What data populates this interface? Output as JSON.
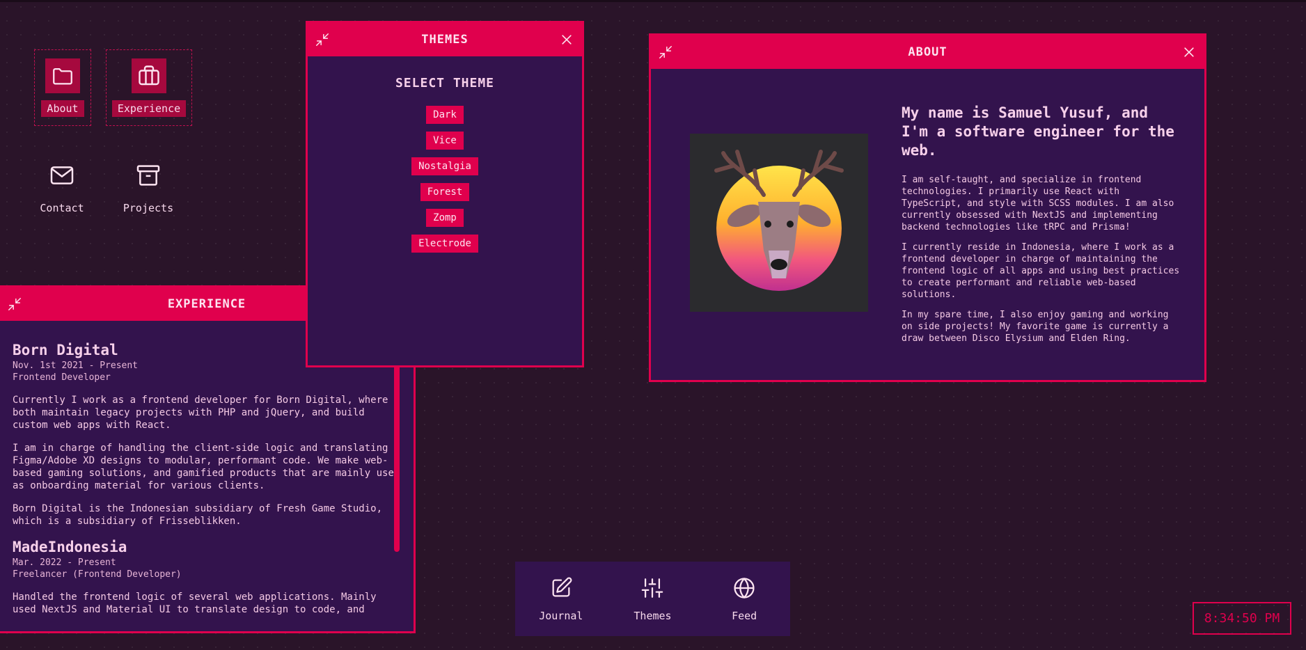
{
  "desktop": {
    "icons": [
      {
        "label": "About",
        "icon": "folder-icon",
        "selected": true
      },
      {
        "label": "Experience",
        "icon": "briefcase-icon",
        "selected": true
      },
      {
        "label": "Contact",
        "icon": "mail-icon",
        "selected": false
      },
      {
        "label": "Projects",
        "icon": "archive-icon",
        "selected": false
      }
    ]
  },
  "themes_window": {
    "title": "THEMES",
    "heading": "SELECT THEME",
    "options": [
      "Dark",
      "Vice",
      "Nostalgia",
      "Forest",
      "Zomp",
      "Electrode"
    ]
  },
  "about_window": {
    "title": "ABOUT",
    "heading": "My name is Samuel Yusuf, and I'm a software engineer for the web.",
    "paragraphs": [
      "I am self-taught, and specialize in frontend technologies. I primarily use React with TypeScript, and style with SCSS modules. I am also currently obsessed with NextJS and implementing backend technologies like tRPC and Prisma!",
      "I currently reside in Indonesia, where I work as a frontend developer in charge of maintaining the frontend logic of all apps and using best practices to create performant and reliable web-based solutions.",
      "In my spare time, I also enjoy gaming and working on side projects! My favorite game is currently a draw between Disco Elysium and Elden Ring."
    ],
    "image": "deer-portrait"
  },
  "experience_window": {
    "title": "EXPERIENCE",
    "jobs": [
      {
        "company": "Born Digital",
        "dates": "Nov. 1st 2021 - Present",
        "role": "Frontend Developer",
        "paragraphs": [
          "Currently I work as a frontend developer for Born Digital, where I both maintain legacy projects with PHP and jQuery, and build custom web apps with React.",
          "I am in charge of handling the client-side logic and translating Figma/Adobe XD designs to modular, performant code. We make web-based gaming solutions, and gamified products that are mainly used as onboarding material for various clients.",
          "Born Digital is the Indonesian subsidiary of Fresh Game Studio, which is a subsidiary of Frisseblikken."
        ]
      },
      {
        "company": "MadeIndonesia",
        "dates": "Mar. 2022 - Present",
        "role": "Freelancer (Frontend Developer)",
        "paragraphs": [
          "Handled the frontend logic of several web applications. Mainly used NextJS and Material UI to translate design to code, and"
        ]
      }
    ]
  },
  "dock": {
    "items": [
      {
        "label": "Journal",
        "icon": "edit-icon"
      },
      {
        "label": "Themes",
        "icon": "sliders-icon"
      },
      {
        "label": "Feed",
        "icon": "globe-icon"
      }
    ]
  },
  "clock": {
    "time": "8:34:50 PM"
  },
  "colors": {
    "accent": "#e0004d",
    "window_bg": "#33134d",
    "desktop_bg": "#2a1429",
    "text": "#f7c6e6"
  }
}
